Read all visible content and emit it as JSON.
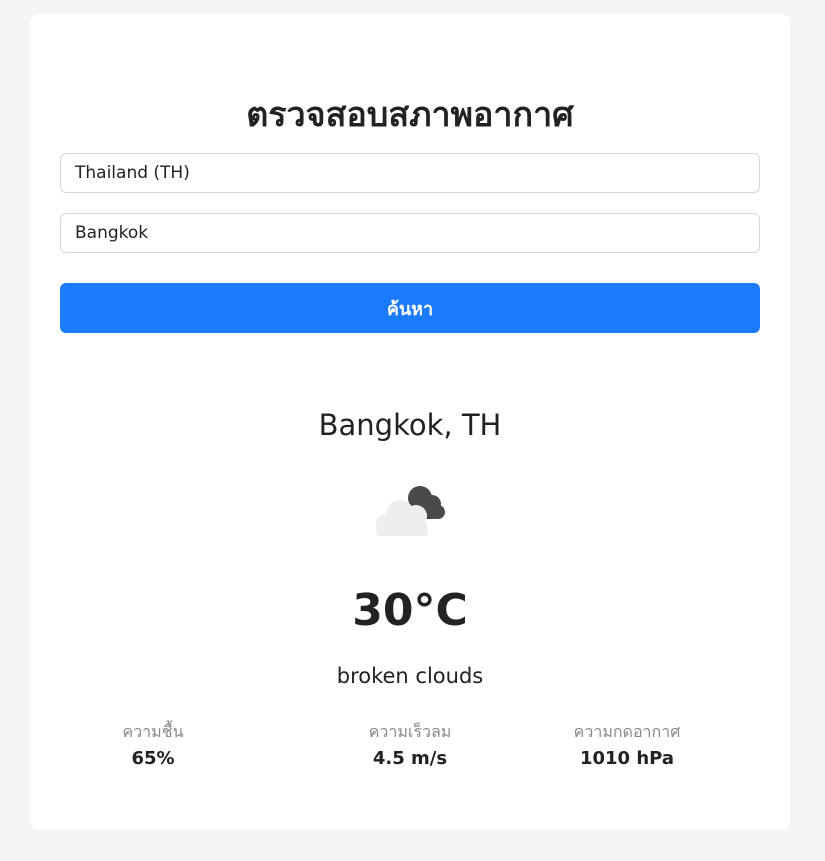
{
  "header": {
    "title": "ตรวจสอบสภาพอากาศ"
  },
  "form": {
    "country_value": "Thailand (TH)",
    "city_value": "Bangkok",
    "search_label": "ค้นหา"
  },
  "result": {
    "location": "Bangkok, TH",
    "icon": "broken-clouds-icon",
    "temperature": "30°C",
    "description": "broken clouds"
  },
  "stats": [
    {
      "label": "ความชื้น",
      "value": "65%"
    },
    {
      "label": "ความเร็วลม",
      "value": "4.5 m/s"
    },
    {
      "label": "ความกดอากาศ",
      "value": "1010 hPa"
    }
  ],
  "colors": {
    "background": "#f4f4f4",
    "card": "#ffffff",
    "accent": "#1a7bff",
    "text": "#222222",
    "muted": "#888888",
    "cloud_light": "#eeeeee",
    "cloud_dark": "#4a4a4a"
  }
}
